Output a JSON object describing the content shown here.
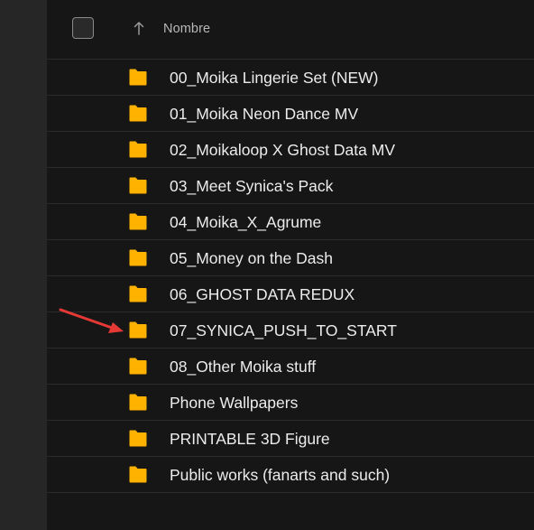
{
  "header": {
    "sort_direction": "ascending",
    "column_label": "Nombre"
  },
  "folders": [
    {
      "label": "00_Moika Lingerie Set (NEW)"
    },
    {
      "label": "01_Moika Neon Dance MV"
    },
    {
      "label": "02_Moikaloop X Ghost Data MV"
    },
    {
      "label": "03_Meet Synica's Pack"
    },
    {
      "label": "04_Moika_X_Agrume"
    },
    {
      "label": "05_Money on the Dash"
    },
    {
      "label": "06_GHOST DATA REDUX"
    },
    {
      "label": "07_SYNICA_PUSH_TO_START"
    },
    {
      "label": "08_Other Moika stuff"
    },
    {
      "label": "Phone Wallpapers"
    },
    {
      "label": "PRINTABLE 3D Figure"
    },
    {
      "label": "Public works (fanarts and such)"
    }
  ],
  "highlighted_folder_index": 7,
  "colors": {
    "folder": "#ffb300",
    "annotation_arrow": "#e53935",
    "background": "#161616"
  }
}
